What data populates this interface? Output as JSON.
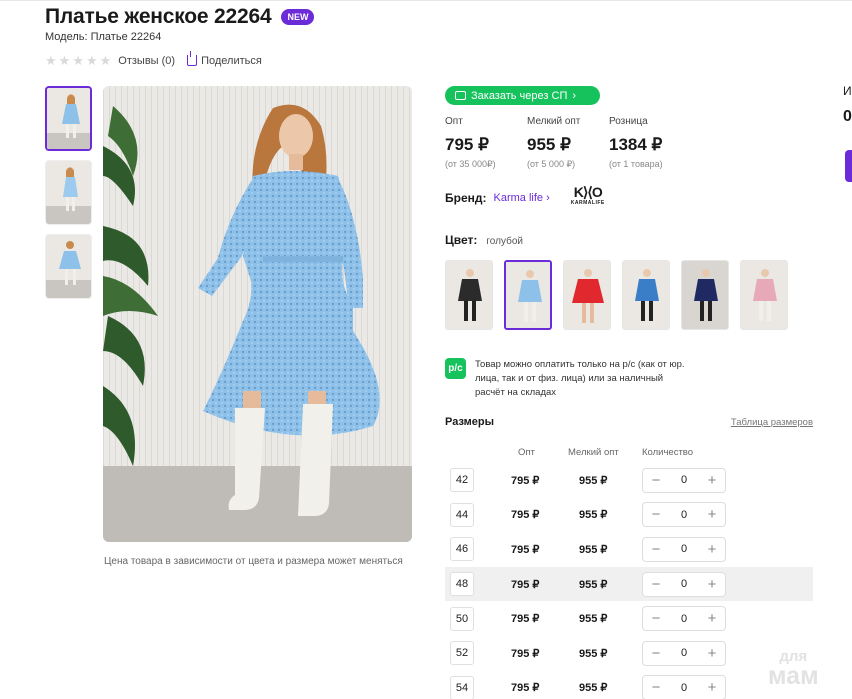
{
  "product": {
    "title": "Платье женское 22264",
    "badge": "NEW",
    "model": "Модель: Платье 22264",
    "reviews": "Отзывы (0)",
    "share": "Поделиться",
    "price_note": "Цена товара в зависимости от цвета и размера может меняться"
  },
  "order_button": "Заказать через СП",
  "prices": [
    {
      "label": "Опт",
      "value": "795 ₽",
      "note": "(от 35 000₽)"
    },
    {
      "label": "Мелкий опт",
      "value": "955 ₽",
      "note": "(от 5 000 ₽)"
    },
    {
      "label": "Розница",
      "value": "1384 ₽",
      "note": "(от 1 товара)"
    }
  ],
  "brand": {
    "label": "Бренд:",
    "name": "Karma life",
    "logo_mark": "K⟩⟨O",
    "logo_text": "KARMALIFE"
  },
  "color": {
    "label": "Цвет:",
    "value": "голубой"
  },
  "swatch_colors": [
    "#2b2b2b",
    "#8ec1ea",
    "#e0282e",
    "#3a7ec7",
    "#1f2a63",
    "#e7a9b7"
  ],
  "payment_note": {
    "icon": "р/с",
    "text": "Товар можно оплатить только на р/с (как от юр. лица, так и от физ. лица) или за наличный расчёт на складах"
  },
  "sizes": {
    "label": "Размеры",
    "table_link": "Таблица размеров",
    "headers": {
      "opt": "Опт",
      "small": "Мелкий опт",
      "qty": "Количество"
    },
    "rows": [
      {
        "size": "42",
        "opt": "795 ₽",
        "small": "955 ₽",
        "qty": "0"
      },
      {
        "size": "44",
        "opt": "795 ₽",
        "small": "955 ₽",
        "qty": "0"
      },
      {
        "size": "46",
        "opt": "795 ₽",
        "small": "955 ₽",
        "qty": "0"
      },
      {
        "size": "48",
        "opt": "795 ₽",
        "small": "955 ₽",
        "qty": "0"
      },
      {
        "size": "50",
        "opt": "795 ₽",
        "small": "955 ₽",
        "qty": "0"
      },
      {
        "size": "52",
        "opt": "795 ₽",
        "small": "955 ₽",
        "qty": "0"
      },
      {
        "size": "54",
        "opt": "795 ₽",
        "small": "955 ₽",
        "qty": "0"
      }
    ],
    "minus": "−",
    "plus": "+"
  },
  "edge": {
    "a": "И",
    "b": "0"
  },
  "watermark": {
    "line1": "для",
    "line2": "мам"
  },
  "accent": "#6b2bd9",
  "green": "#16c25c"
}
